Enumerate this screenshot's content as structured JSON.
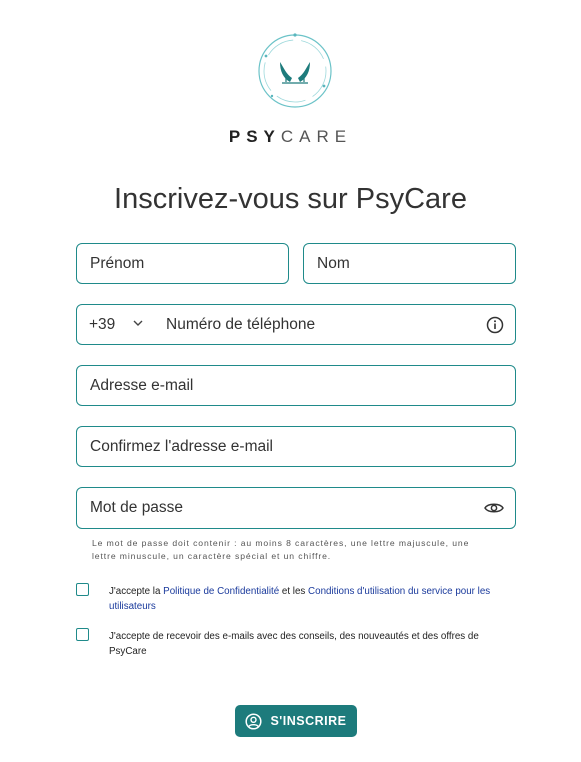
{
  "brand": {
    "part1": "PSY",
    "part2": "CARE"
  },
  "title": "Inscrivez-vous sur PsyCare",
  "form": {
    "first_name": {
      "placeholder": "Prénom"
    },
    "last_name": {
      "placeholder": "Nom"
    },
    "phone": {
      "prefix": "+39",
      "placeholder": "Numéro de téléphone"
    },
    "email": {
      "placeholder": "Adresse e-mail"
    },
    "email_confirm": {
      "placeholder": "Confirmez l'adresse e-mail"
    },
    "password": {
      "placeholder": "Mot de passe"
    },
    "password_hint": "Le mot de passe doit contenir : au moins 8 caractères, une lettre majuscule, une lettre minuscule, un caractère spécial et un chiffre."
  },
  "consent_privacy": {
    "before": "J'accepte la ",
    "link1": "Politique de Confidentialité",
    "middle": " et les ",
    "link2": "Conditions d'utilisation du service pour les utilisateurs"
  },
  "consent_marketing": {
    "text": "J'accepte de recevoir des e-mails avec des conseils, des nouveautés et des offres de PsyCare"
  },
  "submit": {
    "label": "S'INSCRIRE"
  },
  "colors": {
    "accent": "#1f8a8a",
    "button": "#1d7b7c",
    "link": "#1a3a9c"
  }
}
